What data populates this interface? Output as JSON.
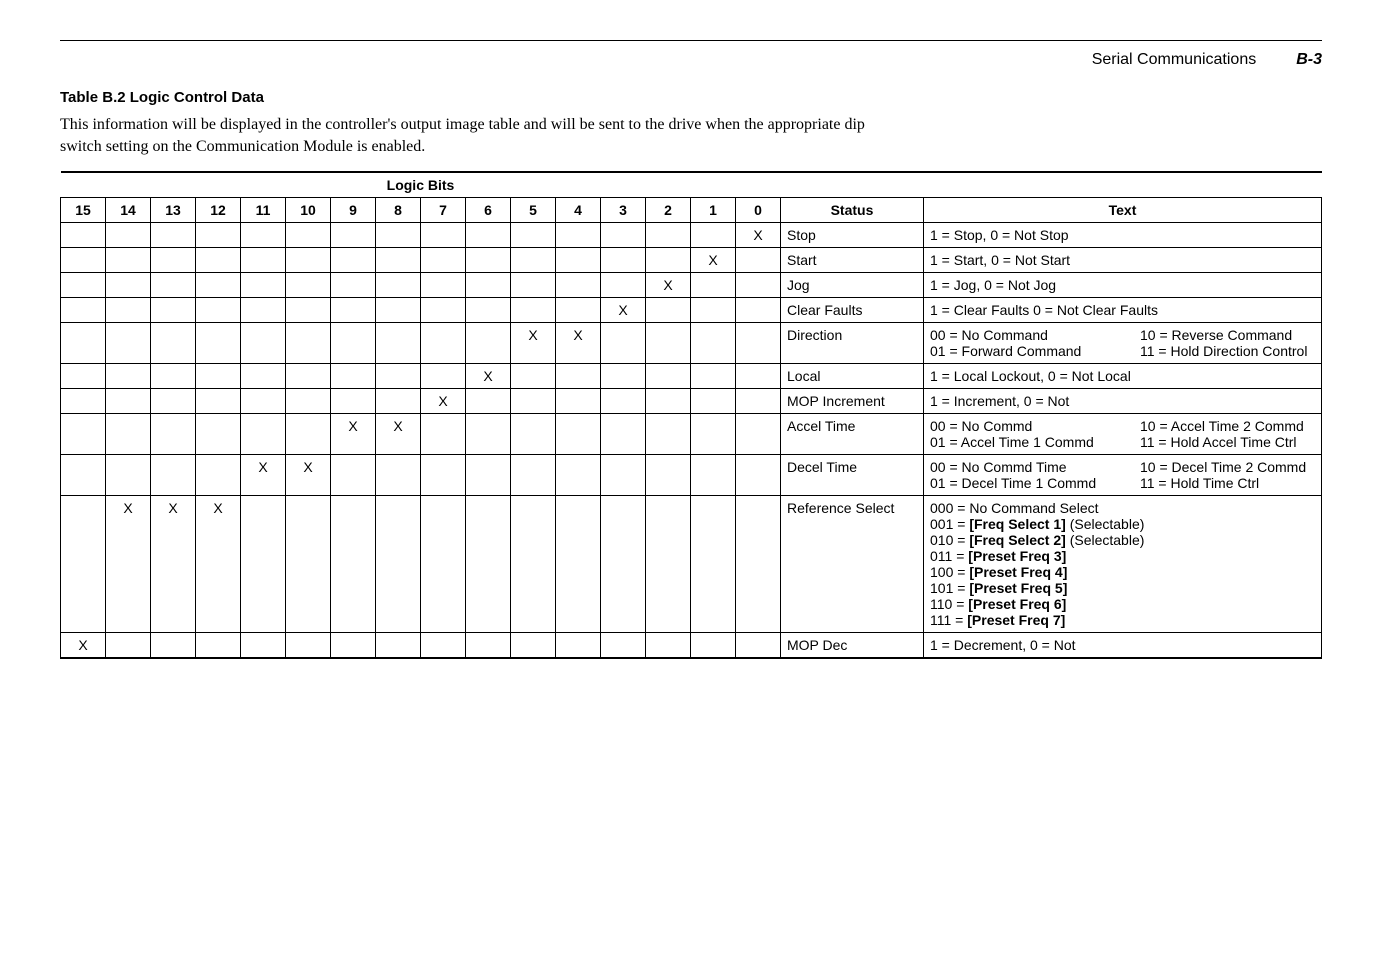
{
  "header": {
    "doc_title": "Serial Communications",
    "page_num": "B-3"
  },
  "table_caption": "Table B.2  Logic Control Data",
  "intro": "This information will be displayed in the controller's output image table and will be sent to the drive when the appropriate dip switch setting on the Communication Module is enabled.",
  "logic_bits_label": "Logic Bits",
  "bit_headers": [
    "15",
    "14",
    "13",
    "12",
    "11",
    "10",
    "9",
    "8",
    "7",
    "6",
    "5",
    "4",
    "3",
    "2",
    "1",
    "0"
  ],
  "col_status": "Status",
  "col_text": "Text",
  "rows": [
    {
      "bits": [
        "",
        "",
        "",
        "",
        "",
        "",
        "",
        "",
        "",
        "",
        "",
        "",
        "",
        "",
        "",
        "X"
      ],
      "status": "Stop",
      "text": "1 = Stop, 0 = Not Stop"
    },
    {
      "bits": [
        "",
        "",
        "",
        "",
        "",
        "",
        "",
        "",
        "",
        "",
        "",
        "",
        "",
        "",
        "X",
        ""
      ],
      "status": "Start",
      "text": "1 = Start, 0 = Not Start"
    },
    {
      "bits": [
        "",
        "",
        "",
        "",
        "",
        "",
        "",
        "",
        "",
        "",
        "",
        "",
        "",
        "X",
        "",
        ""
      ],
      "status": "Jog",
      "text": "1 = Jog, 0 = Not Jog"
    },
    {
      "bits": [
        "",
        "",
        "",
        "",
        "",
        "",
        "",
        "",
        "",
        "",
        "",
        "",
        "X",
        "",
        "",
        ""
      ],
      "status": "Clear Faults",
      "text": "1 = Clear Faults   0 = Not Clear Faults"
    },
    {
      "bits": [
        "",
        "",
        "",
        "",
        "",
        "",
        "",
        "",
        "",
        "",
        "X",
        "X",
        "",
        "",
        "",
        ""
      ],
      "status": "Direction",
      "text_pairs": [
        [
          "00 = No Command",
          "10 = Reverse Command"
        ],
        [
          "01 = Forward Command",
          "11 = Hold Direction Control"
        ]
      ]
    },
    {
      "bits": [
        "",
        "",
        "",
        "",
        "",
        "",
        "",
        "",
        "",
        "X",
        "",
        "",
        "",
        "",
        "",
        ""
      ],
      "status": "Local",
      "text": "1 = Local Lockout, 0 = Not  Local"
    },
    {
      "bits": [
        "",
        "",
        "",
        "",
        "",
        "",
        "",
        "",
        "X",
        "",
        "",
        "",
        "",
        "",
        "",
        ""
      ],
      "status": "MOP Increment",
      "text": "1 = Increment, 0 = Not"
    },
    {
      "bits": [
        "",
        "",
        "",
        "",
        "",
        "",
        "X",
        "X",
        "",
        "",
        "",
        "",
        "",
        "",
        "",
        ""
      ],
      "status": "Accel Time",
      "text_pairs": [
        [
          "00 = No Commd",
          "10 = Accel Time 2 Commd"
        ],
        [
          "01 = Accel Time 1 Commd",
          "11 = Hold Accel Time Ctrl"
        ]
      ]
    },
    {
      "bits": [
        "",
        "",
        "",
        "",
        "X",
        "X",
        "",
        "",
        "",
        "",
        "",
        "",
        "",
        "",
        "",
        ""
      ],
      "status": "Decel Time",
      "text_pairs": [
        [
          "00 = No Commd Time",
          "10 = Decel Time 2 Commd"
        ],
        [
          "01 = Decel Time 1 Commd",
          "11 = Hold Time Ctrl"
        ]
      ]
    },
    {
      "bits": [
        "",
        "X",
        "X",
        "X",
        "",
        "",
        "",
        "",
        "",
        "",
        "",
        "",
        "",
        "",
        "",
        ""
      ],
      "status": "Reference Select",
      "ref_lines": [
        {
          "code": "000 = ",
          "label": "No Command Select",
          "bold": false
        },
        {
          "code": "001 = ",
          "label": "[Freq Select 1]",
          "suffix": " (Selectable)",
          "bold": true
        },
        {
          "code": "010 = ",
          "label": "[Freq Select 2]",
          "suffix": " (Selectable)",
          "bold": true
        },
        {
          "code": "011 = ",
          "label": "[Preset Freq 3]",
          "bold": true
        },
        {
          "code": "100 = ",
          "label": "[Preset Freq 4]",
          "bold": true
        },
        {
          "code": "101 = ",
          "label": "[Preset Freq 5]",
          "bold": true
        },
        {
          "code": "110 = ",
          "label": "[Preset Freq 6]",
          "bold": true
        },
        {
          "code": "111 = ",
          "label": "[Preset Freq 7]",
          "bold": true
        }
      ]
    },
    {
      "bits": [
        "X",
        "",
        "",
        "",
        "",
        "",
        "",
        "",
        "",
        "",
        "",
        "",
        "",
        "",
        "",
        ""
      ],
      "status": "MOP Dec",
      "text": "1 = Decrement, 0 = Not"
    }
  ]
}
